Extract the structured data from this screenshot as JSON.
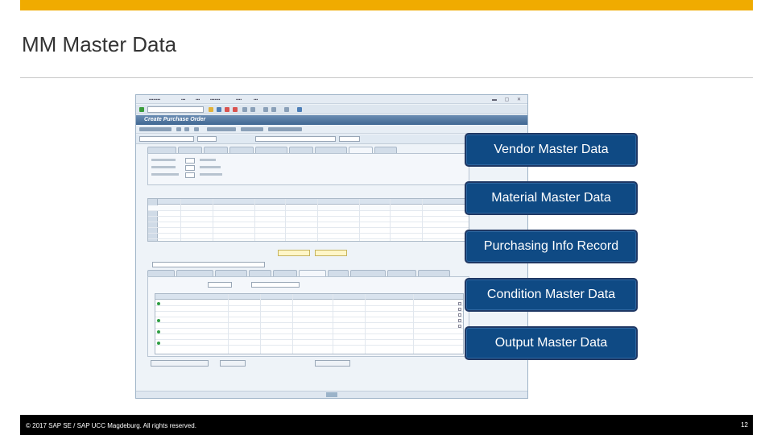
{
  "slide": {
    "title": "MM Master Data",
    "accent_color": "#f0ab00",
    "callout_color": "#0f4a84"
  },
  "callouts": [
    "Vendor Master Data",
    "Material Master Data",
    "Purchasing Info Record",
    "Condition Master Data",
    "Output Master Data"
  ],
  "sap_window": {
    "screen_title": "Create Purchase Order"
  },
  "footer": {
    "copyright": "© 2017 SAP SE / SAP UCC Magdeburg. All rights reserved.",
    "page_number": "12"
  }
}
